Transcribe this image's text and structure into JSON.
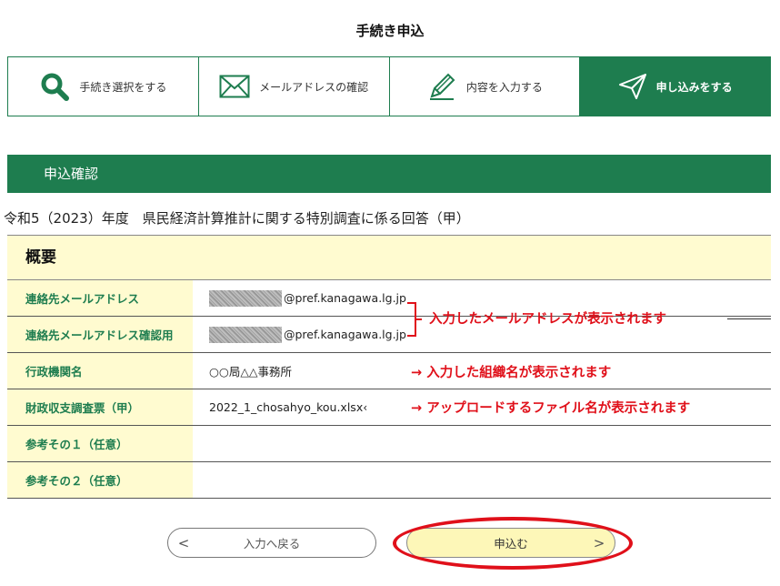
{
  "header": {
    "title": "手続き申込"
  },
  "steps": [
    {
      "label": "手続き選択をする",
      "icon": "search-icon"
    },
    {
      "label": "メールアドレスの確認",
      "icon": "mail-icon"
    },
    {
      "label": "内容を入力する",
      "icon": "pencil-icon"
    },
    {
      "label": "申し込みをする",
      "icon": "paper-plane-icon",
      "active": true
    }
  ],
  "section": {
    "title": "申込確認"
  },
  "survey_title": "令和5（2023）年度　県民経済計算推計に関する特別調査に係る回答（甲）",
  "summary": {
    "heading": "概要",
    "rows": [
      {
        "label": "連絡先メールアドレス",
        "value": "@pref.kanagawa.lg.jp"
      },
      {
        "label": "連絡先メールアドレス確認用",
        "value": "@pref.kanagawa.lg.jp"
      },
      {
        "label": "行政機関名",
        "value": "○○局△△事務所"
      },
      {
        "label": "財政収支調査票（甲）",
        "value": "2022_1_chosahyo_kou.xlsx‹"
      },
      {
        "label": "参考その１（任意）",
        "value": ""
      },
      {
        "label": "参考その２（任意）",
        "value": ""
      }
    ]
  },
  "annotations": {
    "email": "入力したメールアドレスが表示されます",
    "org": "→ 入力した組織名が表示されます",
    "file": "→ アップロードするファイル名が表示されます"
  },
  "buttons": {
    "back_label": "入力へ戻る",
    "back_chevron": "<",
    "submit_label": "申込む",
    "submit_chevron": ">"
  },
  "colors": {
    "brand_green": "#1e7d4f",
    "highlight_yellow": "#fffbd0",
    "annotation_red": "#e0101a"
  }
}
